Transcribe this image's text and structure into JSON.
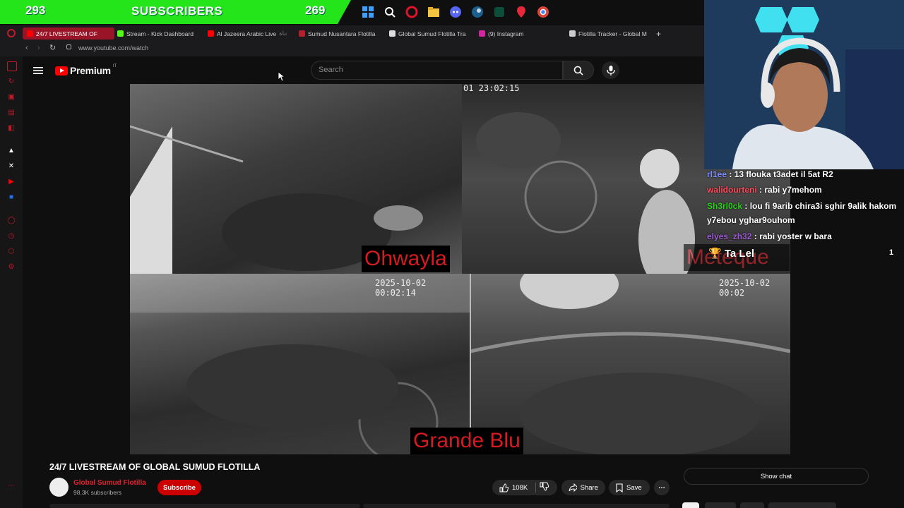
{
  "subscriber_bar": {
    "left_count": "293",
    "label": "SUBSCRIBERS",
    "right_count": "269"
  },
  "taskbar": {
    "icons": [
      "windows-icon",
      "search-icon",
      "opera-icon",
      "folder-icon",
      "discord-icon",
      "steam-icon",
      "app-icon",
      "map-pin-icon",
      "chrome-icon"
    ]
  },
  "tabs": [
    {
      "label": "24/7 LIVESTREAM OF",
      "active": true
    },
    {
      "label": "Stream - Kick Dashboard"
    },
    {
      "label": "Al Jazeera Arabic Live",
      "suffix": "قناة"
    },
    {
      "label": "Sumud Nusantara Flotilla"
    },
    {
      "label": "Global Sumud Flotilla Tra"
    },
    {
      "label": "(9) Instagram"
    },
    {
      "label": "Flotilla Tracker - Global M"
    }
  ],
  "address_bar": {
    "url": "www.youtube.com/watch"
  },
  "youtube": {
    "logo": "Premium",
    "logo_region": "IT",
    "search_placeholder": "Search"
  },
  "video": {
    "cam1_timestamp": "01 23:02:15",
    "cam3_timestamp": "2025-10-02 00:02:14",
    "cam4_timestamp": "2025-10-02 00:02",
    "labels": [
      "Ohwayla",
      "Meteque",
      "Grande Blu"
    ]
  },
  "chat": {
    "messages": [
      {
        "user": "rl1ee",
        "text": "13 flouka t3adet il 5at R2"
      },
      {
        "user": "walidourteni",
        "text": "rabi y7mehom"
      },
      {
        "user": "Sh3rl0ck",
        "text": "lou fi 9arib chira3i sghir 9alik hakom"
      },
      {
        "user": "",
        "text": "y7ebou yghar9ouhom"
      },
      {
        "user": "elyes_zh32",
        "text": "rabi yoster w bara"
      }
    ],
    "pinned": {
      "text": "Ta Lel",
      "count": "1"
    }
  },
  "below_video": {
    "title": "24/7 LIVESTREAM OF GLOBAL SUMUD FLOTILLA",
    "channel_name": "Global Sumud Flotilla",
    "channel_subs": "98.3K subscribers",
    "subscribe_label": "Subscribe",
    "likes": "108K",
    "share_label": "Share",
    "save_label": "Save",
    "show_chat_label": "Show chat"
  },
  "colors": {
    "accent_red": "#cc0000",
    "sub_bar_green": "#22e01a",
    "chat_name_green": "#2bd11c"
  }
}
